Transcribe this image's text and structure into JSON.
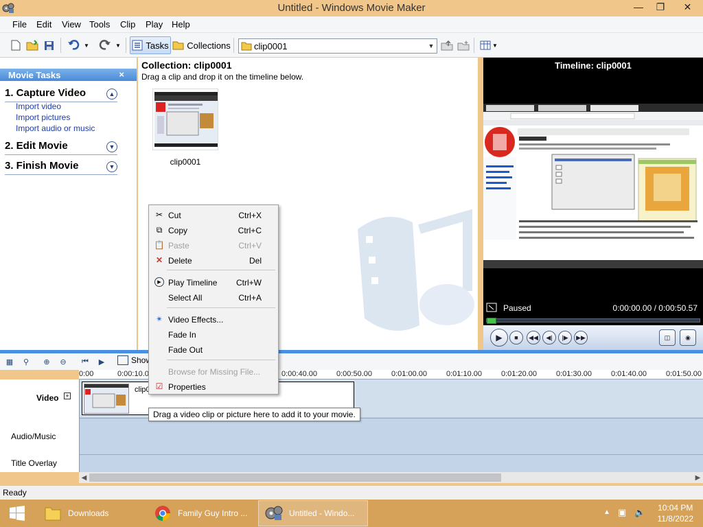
{
  "window": {
    "title": "Untitled - Windows Movie Maker"
  },
  "menu": [
    "File",
    "Edit",
    "View",
    "Tools",
    "Clip",
    "Play",
    "Help"
  ],
  "toolbar": {
    "tasks_label": "Tasks",
    "collections_label": "Collections",
    "collection_value": "clip0001"
  },
  "tasks_pane": {
    "title": "Movie Tasks",
    "close_glyph": "×",
    "groups": [
      {
        "label": "1. Capture Video",
        "expanded": true,
        "links": [
          "Import video",
          "Import pictures",
          "Import audio or music"
        ]
      },
      {
        "label": "2. Edit Movie",
        "expanded": false
      },
      {
        "label": "3. Finish Movie",
        "expanded": false
      }
    ]
  },
  "collection": {
    "title": "Collection: clip0001",
    "subtitle": "Drag a clip and drop it on the timeline below.",
    "clips": [
      {
        "name": "clip0001"
      }
    ]
  },
  "monitor": {
    "title": "Timeline: clip0001",
    "status": "Paused",
    "time": "0:00:00.00 / 0:00:50.57",
    "progress": 0
  },
  "timeline": {
    "show_label": "Show",
    "ruler": [
      "0:00",
      "0:00:10.00",
      "0:00:40.00",
      "0:00:50.00",
      "0:01:00.00",
      "0:01:10.00",
      "0:01:20.00",
      "0:01:30.00",
      "0:01:40.00",
      "0:01:50.00"
    ],
    "tracks": [
      "Video",
      "Audio/Music",
      "Title Overlay"
    ],
    "clip_name": "clip0001",
    "tooltip": "Drag a video clip or picture here to add it to your movie."
  },
  "context_menu": {
    "items": [
      {
        "label": "Cut",
        "shortcut": "Ctrl+X",
        "icon": "scissors-icon",
        "enabled": true
      },
      {
        "label": "Copy",
        "shortcut": "Ctrl+C",
        "icon": "copy-icon",
        "enabled": true
      },
      {
        "label": "Paste",
        "shortcut": "Ctrl+V",
        "icon": "paste-icon",
        "enabled": false
      },
      {
        "label": "Delete",
        "shortcut": "Del",
        "icon": "delete-x-icon",
        "enabled": true
      },
      {
        "label": "Play Timeline",
        "shortcut": "Ctrl+W",
        "icon": "play-icon",
        "enabled": true
      },
      {
        "label": "Select All",
        "shortcut": "Ctrl+A",
        "enabled": true
      },
      {
        "label": "Video Effects...",
        "icon": "star-effects-icon",
        "enabled": true
      },
      {
        "label": "Fade In",
        "enabled": true
      },
      {
        "label": "Fade Out",
        "enabled": true
      },
      {
        "label": "Browse for Missing File...",
        "enabled": false
      },
      {
        "label": "Properties",
        "icon": "properties-check-icon",
        "enabled": true
      }
    ]
  },
  "statusbar": {
    "text": "Ready"
  },
  "taskbar": {
    "items": [
      {
        "label": "Downloads",
        "icon": "folder-icon"
      },
      {
        "label": "Family Guy Intro ...",
        "icon": "chrome-icon"
      },
      {
        "label": "Untitled - Windo...",
        "icon": "movie-maker-icon",
        "active": true
      }
    ],
    "clock_time": "10:04 PM",
    "clock_date": "11/8/2022"
  },
  "colors": {
    "title_bar": "#f0c68a",
    "taskbar": "#d6a25a",
    "accent_blue": "#4a90e2",
    "link": "#1c3ca8"
  }
}
